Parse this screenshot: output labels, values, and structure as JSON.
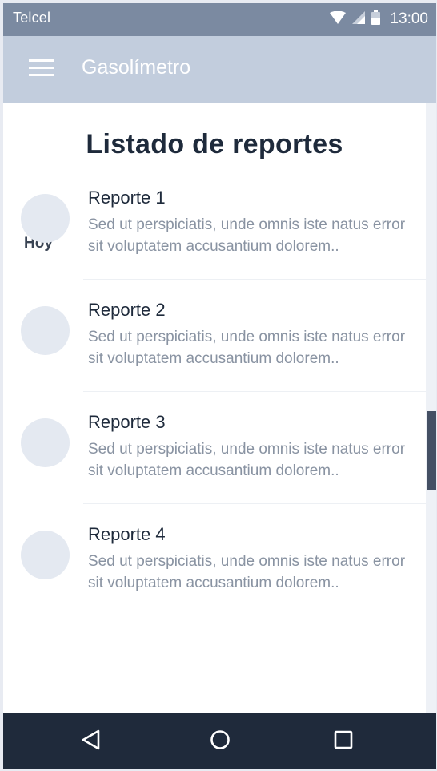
{
  "status_bar": {
    "carrier": "Telcel",
    "time": "13:00",
    "icons": [
      "wifi-icon",
      "signal-icon",
      "battery-icon"
    ]
  },
  "app_bar": {
    "menu_icon": "hamburger-menu-icon",
    "title": "Gasolímetro"
  },
  "main": {
    "page_title": "Listado de reportes",
    "section_label": "Hoy",
    "items": [
      {
        "title": "Reporte 1",
        "text": "Sed ut perspiciatis, unde omnis iste natus error sit voluptatem accusantium dolorem.."
      },
      {
        "title": "Reporte 2",
        "text": "Sed ut perspiciatis, unde omnis iste natus error sit voluptatem accusantium dolorem.."
      },
      {
        "title": "Reporte 3",
        "text": "Sed ut perspiciatis, unde omnis iste natus error sit voluptatem accusantium dolorem.."
      },
      {
        "title": "Reporte 4",
        "text": "Sed ut perspiciatis, unde omnis iste natus error sit voluptatem accusantium dolorem.."
      }
    ]
  },
  "nav_bar": {
    "icons": [
      "back-icon",
      "home-icon",
      "recents-icon"
    ]
  },
  "colors": {
    "status_bar": "#7b8aa1",
    "app_bar": "#c2cddd",
    "title_text": "#1e2a3b",
    "body_text": "#8993a2",
    "avatar": "#e4e9f1",
    "nav_bar": "#1f2a3b"
  }
}
